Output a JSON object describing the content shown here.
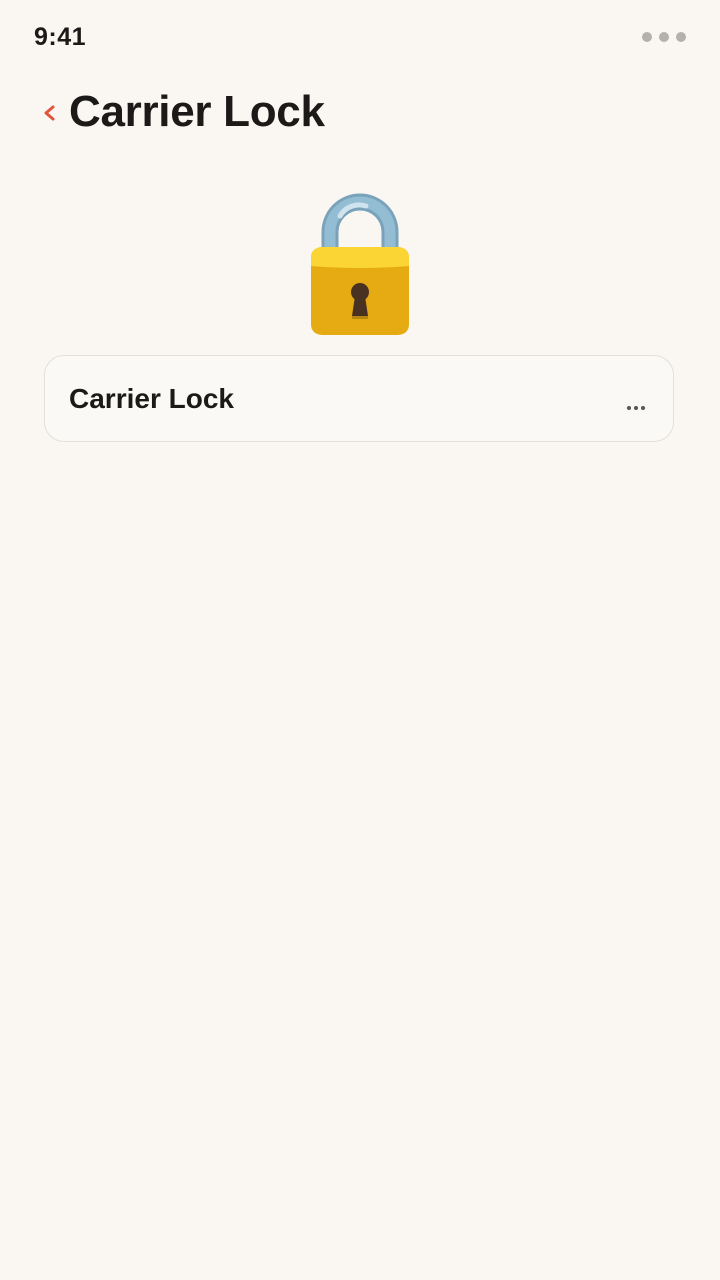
{
  "status_bar": {
    "time": "9:41",
    "menu_icon": "ellipsis-icon"
  },
  "header": {
    "back_icon": "chevron-left-icon",
    "title": "Carrier Lock"
  },
  "hero": {
    "icon": "padlock-icon"
  },
  "card": {
    "label": "Carrier Lock",
    "more": "..."
  },
  "colors": {
    "background": "#faf7f3",
    "accent": "#e2553a",
    "text": "#1c1a18",
    "card_border": "#e3dfda",
    "lock_body": "#e6ab13",
    "lock_shackle": "#8db5cc"
  }
}
